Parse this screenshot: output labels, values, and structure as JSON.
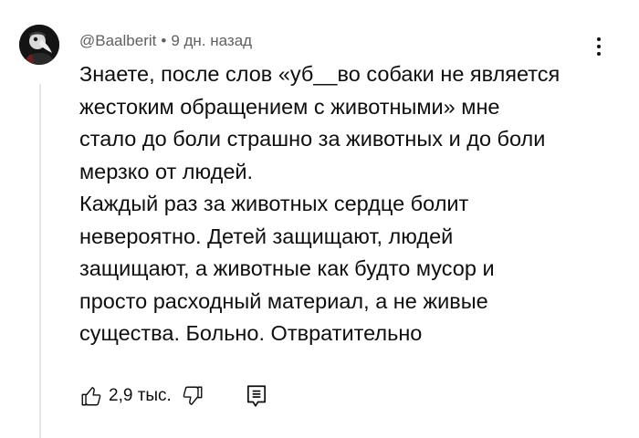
{
  "comment": {
    "author": "@Baalberit",
    "separator": "•",
    "timestamp": "9 дн. назад",
    "paragraphs": [
      "Знаете, после слов «уб__во собаки не является\nжестоким обращением с животными» мне\nстало до боли страшно за животных и до боли\nмерзко от людей.",
      "Каждый раз за животных сердце болит\nневероятно. Детей защищают, людей\nзащищают, а животные как будто мусор и\nпросто расходный материал, а не живые\nсущества. Больно. Отвратительно"
    ],
    "likes": "2,9 тыс."
  },
  "icons": {
    "menu": "more-vertical-icon",
    "like": "thumb-up-icon",
    "dislike": "thumb-down-icon",
    "reply": "reply-comment-icon"
  },
  "colors": {
    "text": "#0f0f0f",
    "secondary_text": "#606060",
    "thread_line": "#e5e5e5",
    "avatar_bg": "#141414"
  }
}
